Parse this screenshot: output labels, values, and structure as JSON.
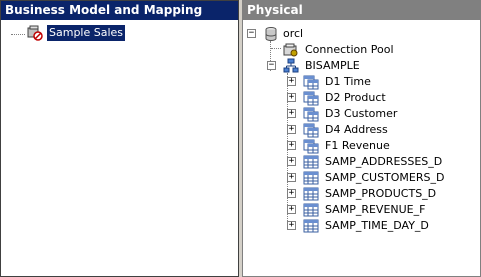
{
  "left_pane": {
    "title": "Business Model and Mapping",
    "items": [
      {
        "label": "Sample Sales",
        "icon": "business-model-icon"
      }
    ]
  },
  "right_pane": {
    "title": "Physical",
    "database": {
      "label": "orcl",
      "icon": "database-icon"
    },
    "connection_pool": {
      "label": "Connection Pool",
      "icon": "connection-pool-icon"
    },
    "schema": {
      "label": "BISAMPLE",
      "icon": "schema-icon"
    },
    "aliases": [
      {
        "label": "D1 Time"
      },
      {
        "label": "D2 Product"
      },
      {
        "label": "D3 Customer"
      },
      {
        "label": "D4 Address"
      },
      {
        "label": "F1 Revenue"
      }
    ],
    "tables": [
      {
        "label": "SAMP_ADDRESSES_D"
      },
      {
        "label": "SAMP_CUSTOMERS_D"
      },
      {
        "label": "SAMP_PRODUCTS_D"
      },
      {
        "label": "SAMP_REVENUE_F"
      },
      {
        "label": "SAMP_TIME_DAY_D"
      }
    ]
  },
  "colors": {
    "active_header": "#0a246a",
    "inactive_header": "#808080",
    "window_bg": "#d4d0c8"
  }
}
